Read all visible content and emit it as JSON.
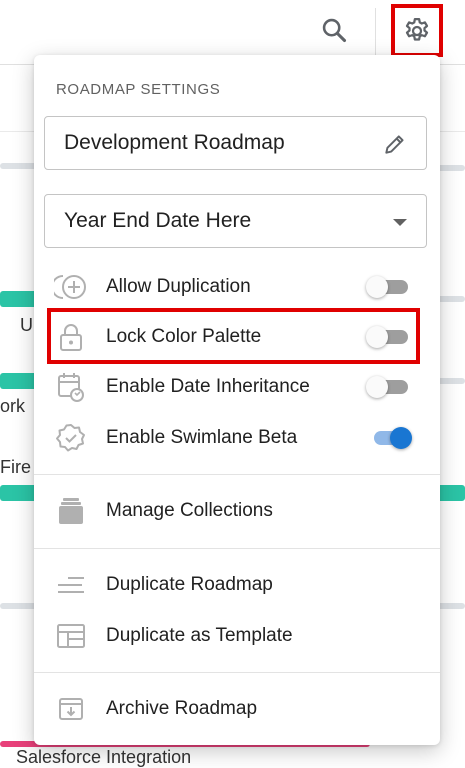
{
  "settings_menu": {
    "title": "ROADMAP SETTINGS",
    "roadmap_name": "Development Roadmap",
    "date_select_value": "Year End Date Here",
    "toggles": [
      {
        "label": "Allow Duplication",
        "icon": "copy-plus-icon",
        "on": false
      },
      {
        "label": "Lock Color Palette",
        "icon": "lock-icon",
        "on": false
      },
      {
        "label": "Enable Date Inheritance",
        "icon": "calendar-refresh-icon",
        "on": false
      },
      {
        "label": "Enable Swimlane Beta",
        "icon": "badge-check-icon",
        "on": true
      }
    ],
    "actions": [
      {
        "label": "Manage Collections",
        "icon": "collections-icon"
      },
      {
        "label": "Duplicate Roadmap",
        "icon": "lines-icon"
      },
      {
        "label": "Duplicate as Template",
        "icon": "template-icon"
      },
      {
        "label": "Archive Roadmap",
        "icon": "archive-icon"
      }
    ]
  },
  "background": {
    "text_fragments": [
      "U",
      "ork",
      "Fire",
      "Salesforce Integration"
    ]
  },
  "colors": {
    "highlight": "#e00000",
    "toggle_on": "#1976d2",
    "teal_bar": "#2bc4a6",
    "pink_bar": "#e8407a"
  }
}
